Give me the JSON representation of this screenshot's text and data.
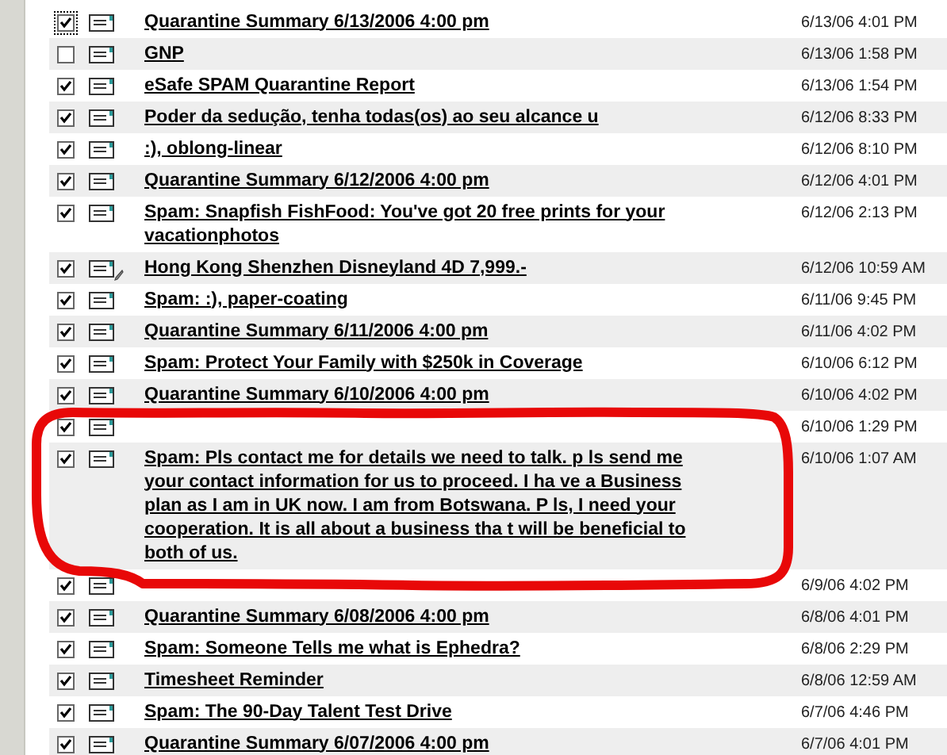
{
  "messages": [
    {
      "subject": "Quarantine Summary 6/13/2006 4:00 pm",
      "date": "6/13/06 4:01 PM",
      "checked": true,
      "focused": true,
      "edited": false
    },
    {
      "subject": "GNP",
      "date": "6/13/06 1:58 PM",
      "checked": false,
      "focused": false,
      "edited": false
    },
    {
      "subject": "eSafe SPAM Quarantine Report",
      "date": "6/13/06 1:54 PM",
      "checked": true,
      "focused": false,
      "edited": false
    },
    {
      "subject": "Poder da sedução, tenha todas(os) ao seu alcance  u",
      "date": "6/12/06 8:33 PM",
      "checked": true,
      "focused": false,
      "edited": false
    },
    {
      "subject": ":), oblong-linear",
      "date": "6/12/06 8:10 PM",
      "checked": true,
      "focused": false,
      "edited": false
    },
    {
      "subject": "Quarantine Summary 6/12/2006 4:00 pm",
      "date": "6/12/06 4:01 PM",
      "checked": true,
      "focused": false,
      "edited": false
    },
    {
      "subject": "Spam: Snapfish FishFood: You've got 20 free prints  for your vacationphotos",
      "date": "6/12/06 2:13 PM",
      "checked": true,
      "focused": false,
      "edited": false
    },
    {
      "subject": "Hong Kong Shenzhen Disneyland 4D 7,999.-",
      "date": "6/12/06 10:59 AM",
      "checked": true,
      "focused": false,
      "edited": true
    },
    {
      "subject": "Spam: :), paper-coating",
      "date": "6/11/06 9:45 PM",
      "checked": true,
      "focused": false,
      "edited": false
    },
    {
      "subject": "Quarantine Summary 6/11/2006 4:00 pm",
      "date": "6/11/06 4:02 PM",
      "checked": true,
      "focused": false,
      "edited": false
    },
    {
      "subject": "Spam: Protect Your Family with $250k in Coverage",
      "date": "6/10/06 6:12 PM",
      "checked": true,
      "focused": false,
      "edited": false
    },
    {
      "subject": "Quarantine Summary 6/10/2006 4:00 pm",
      "date": "6/10/06 4:02 PM",
      "checked": true,
      "focused": false,
      "edited": false
    },
    {
      "date": "6/10/06 1:29 PM",
      "checked": true,
      "focused": false,
      "edited": false
    },
    {
      "subject": "Spam: Pls contact me for details we need to talk. p ls send me your contact information for us to proceed. I ha ve a Business plan as I am in UK now. I am from Botswana. P ls, I need your cooperation. It is all about a business tha t will be beneficial to both of us.",
      "date": "6/10/06 1:07 AM",
      "checked": true,
      "focused": false,
      "edited": false
    },
    {
      "date": "6/9/06 4:02 PM",
      "checked": true,
      "focused": false,
      "edited": false
    },
    {
      "subject": "Quarantine Summary 6/08/2006 4:00 pm",
      "date": "6/8/06 4:01 PM",
      "checked": true,
      "focused": false,
      "edited": false
    },
    {
      "subject": "Spam: Someone Tells me what is Ephedra?",
      "date": "6/8/06 2:29 PM",
      "checked": true,
      "focused": false,
      "edited": false
    },
    {
      "subject": "Timesheet Reminder",
      "date": "6/8/06 12:59 AM",
      "checked": true,
      "focused": false,
      "edited": false
    },
    {
      "subject": "Spam: The 90-Day Talent Test Drive",
      "date": "6/7/06 4:46 PM",
      "checked": true,
      "focused": false,
      "edited": false
    },
    {
      "subject": "Quarantine Summary 6/07/2006 4:00 pm",
      "date": "6/7/06 4:01 PM",
      "checked": true,
      "focused": false,
      "edited": false
    }
  ]
}
